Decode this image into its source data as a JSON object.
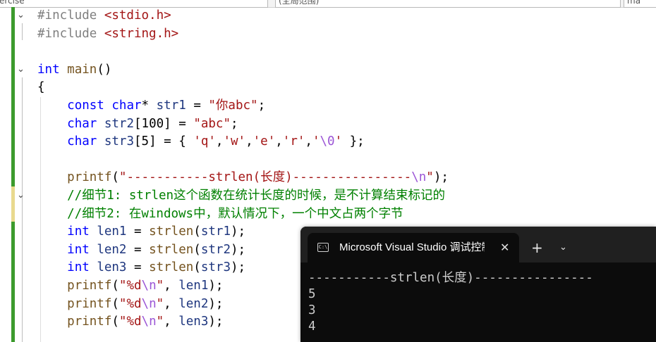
{
  "top_tabs": [
    "erclse",
    "(全局范围)",
    "ma"
  ],
  "code_lines": [
    {
      "tokens": [
        {
          "t": "#include ",
          "c": "pp"
        },
        {
          "t": "<stdio.h>",
          "c": "str"
        }
      ]
    },
    {
      "tokens": [
        {
          "t": "#include ",
          "c": "pp"
        },
        {
          "t": "<string.h>",
          "c": "str"
        }
      ]
    },
    {
      "tokens": []
    },
    {
      "tokens": [
        {
          "t": "int",
          "c": "kw"
        },
        {
          "t": " "
        },
        {
          "t": "main",
          "c": "fn"
        },
        {
          "t": "()"
        }
      ]
    },
    {
      "tokens": [
        {
          "t": "{"
        }
      ]
    },
    {
      "tokens": [
        {
          "t": "    "
        },
        {
          "t": "const",
          "c": "kw"
        },
        {
          "t": " "
        },
        {
          "t": "char",
          "c": "kw"
        },
        {
          "t": "* "
        },
        {
          "t": "str1",
          "c": "var"
        },
        {
          "t": " = "
        },
        {
          "t": "\"你abc\"",
          "c": "str"
        },
        {
          "t": ";"
        }
      ]
    },
    {
      "tokens": [
        {
          "t": "    "
        },
        {
          "t": "char",
          "c": "kw"
        },
        {
          "t": " "
        },
        {
          "t": "str2",
          "c": "var"
        },
        {
          "t": "[100] = "
        },
        {
          "t": "\"abc\"",
          "c": "str"
        },
        {
          "t": ";"
        }
      ]
    },
    {
      "tokens": [
        {
          "t": "    "
        },
        {
          "t": "char",
          "c": "kw"
        },
        {
          "t": " "
        },
        {
          "t": "str3",
          "c": "var"
        },
        {
          "t": "[5] = { "
        },
        {
          "t": "'q'",
          "c": "str"
        },
        {
          "t": ","
        },
        {
          "t": "'w'",
          "c": "str"
        },
        {
          "t": ","
        },
        {
          "t": "'e'",
          "c": "str"
        },
        {
          "t": ","
        },
        {
          "t": "'r'",
          "c": "str"
        },
        {
          "t": ","
        },
        {
          "t": "'",
          "c": "str"
        },
        {
          "t": "\\0",
          "c": "esc"
        },
        {
          "t": "'",
          "c": "str"
        },
        {
          "t": " };"
        }
      ]
    },
    {
      "tokens": []
    },
    {
      "tokens": [
        {
          "t": "    "
        },
        {
          "t": "printf",
          "c": "fn"
        },
        {
          "t": "("
        },
        {
          "t": "\"-----------strlen(长度)----------------",
          "c": "str"
        },
        {
          "t": "\\n",
          "c": "esc"
        },
        {
          "t": "\"",
          "c": "str"
        },
        {
          "t": ");"
        }
      ]
    },
    {
      "tokens": [
        {
          "t": "    "
        },
        {
          "t": "//细节1: strlen这个函数在统计长度的时候，是不计算结束标记的",
          "c": "cmt"
        }
      ]
    },
    {
      "tokens": [
        {
          "t": "    "
        },
        {
          "t": "//细节2: 在windows中，默认情况下，一个中文占两个字节",
          "c": "cmt"
        }
      ]
    },
    {
      "tokens": [
        {
          "t": "    "
        },
        {
          "t": "int",
          "c": "kw"
        },
        {
          "t": " "
        },
        {
          "t": "len1",
          "c": "var"
        },
        {
          "t": " = "
        },
        {
          "t": "strlen",
          "c": "fn"
        },
        {
          "t": "("
        },
        {
          "t": "str1",
          "c": "var"
        },
        {
          "t": ");"
        }
      ]
    },
    {
      "tokens": [
        {
          "t": "    "
        },
        {
          "t": "int",
          "c": "kw"
        },
        {
          "t": " "
        },
        {
          "t": "len2",
          "c": "var"
        },
        {
          "t": " = "
        },
        {
          "t": "strlen",
          "c": "fn"
        },
        {
          "t": "("
        },
        {
          "t": "str2",
          "c": "var"
        },
        {
          "t": ");"
        }
      ]
    },
    {
      "tokens": [
        {
          "t": "    "
        },
        {
          "t": "int",
          "c": "kw"
        },
        {
          "t": " "
        },
        {
          "t": "len3",
          "c": "var"
        },
        {
          "t": " = "
        },
        {
          "t": "strlen",
          "c": "fn"
        },
        {
          "t": "("
        },
        {
          "t": "str3",
          "c": "var"
        },
        {
          "t": ");"
        }
      ]
    },
    {
      "tokens": [
        {
          "t": "    "
        },
        {
          "t": "printf",
          "c": "fn"
        },
        {
          "t": "("
        },
        {
          "t": "\"%d",
          "c": "str"
        },
        {
          "t": "\\n",
          "c": "esc"
        },
        {
          "t": "\"",
          "c": "str"
        },
        {
          "t": ", "
        },
        {
          "t": "len1",
          "c": "var"
        },
        {
          "t": ");"
        }
      ]
    },
    {
      "tokens": [
        {
          "t": "    "
        },
        {
          "t": "printf",
          "c": "fn"
        },
        {
          "t": "("
        },
        {
          "t": "\"%d",
          "c": "str"
        },
        {
          "t": "\\n",
          "c": "esc"
        },
        {
          "t": "\"",
          "c": "str"
        },
        {
          "t": ", "
        },
        {
          "t": "len2",
          "c": "var"
        },
        {
          "t": ");"
        }
      ]
    },
    {
      "tokens": [
        {
          "t": "    "
        },
        {
          "t": "printf",
          "c": "fn"
        },
        {
          "t": "("
        },
        {
          "t": "\"%d",
          "c": "str"
        },
        {
          "t": "\\n",
          "c": "esc"
        },
        {
          "t": "\"",
          "c": "str"
        },
        {
          "t": ", "
        },
        {
          "t": "len3",
          "c": "var"
        },
        {
          "t": ");"
        }
      ]
    }
  ],
  "console": {
    "icon_label": "C:\\",
    "title": "Microsoft Visual Studio 调试控制台",
    "close_icon": "close-icon",
    "new_tab_symbol": "+",
    "dropdown_symbol": "⌄",
    "output_lines": [
      "-----------strlen(长度)----------------",
      "5",
      "3",
      "4"
    ]
  },
  "colors": {
    "keyword": "#0000ff",
    "string": "#a31515",
    "escape": "#9b55d6",
    "preprocessor": "#808080",
    "comment": "#008000",
    "function": "#74531f",
    "variable": "#1f377f",
    "change_bar_saved": "#3c9b2d",
    "change_bar_unsaved": "#e9d98e"
  }
}
